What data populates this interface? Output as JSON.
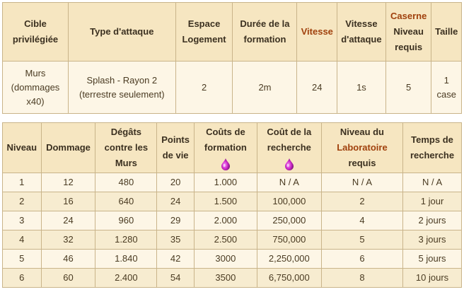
{
  "unit_table": {
    "headers": {
      "target": "Cible privilégiée",
      "attack_type": "Type d'attaque",
      "housing": "Espace Logement",
      "training_time": "Durée de la formation",
      "speed": "Vitesse",
      "attack_speed": "Vitesse d'attaque",
      "barracks_link": "Caserne",
      "barracks_level_label": "Niveau requis",
      "size": "Taille"
    },
    "row": {
      "target": "Murs (dommages x40)",
      "attack_type": "Splash - Rayon 2 (terrestre seulement)",
      "housing": "2",
      "training_time": "2m",
      "speed": "24",
      "attack_speed": "1s",
      "barracks_level": "5",
      "size": "1 case"
    }
  },
  "level_table": {
    "headers": {
      "level": "Niveau",
      "damage": "Dommage",
      "wall_damage": "Dégâts contre les Murs",
      "hitpoints": "Points de vie",
      "training_cost": "Coûts de formation",
      "research_cost": "Coût de la recherche",
      "lab_level_pre": "Niveau du",
      "lab_link": "Laboratoire",
      "lab_level_post": "requis",
      "research_time": "Temps de recherche"
    },
    "resource_icon": "elixir-drop-icon",
    "rows": [
      {
        "level": "1",
        "damage": "12",
        "wall": "480",
        "hp": "20",
        "train": "1.000",
        "research": "N / A",
        "lab": "N / A",
        "time": "N / A"
      },
      {
        "level": "2",
        "damage": "16",
        "wall": "640",
        "hp": "24",
        "train": "1.500",
        "research": "100,000",
        "lab": "2",
        "time": "1 jour"
      },
      {
        "level": "3",
        "damage": "24",
        "wall": "960",
        "hp": "29",
        "train": "2.000",
        "research": "250,000",
        "lab": "4",
        "time": "2 jours"
      },
      {
        "level": "4",
        "damage": "32",
        "wall": "1.280",
        "hp": "35",
        "train": "2.500",
        "research": "750,000",
        "lab": "5",
        "time": "3 jours"
      },
      {
        "level": "5",
        "damage": "46",
        "wall": "1.840",
        "hp": "42",
        "train": "3000",
        "research": "2,250,000",
        "lab": "6",
        "time": "5 jours"
      },
      {
        "level": "6",
        "damage": "60",
        "wall": "2.400",
        "hp": "54",
        "train": "3500",
        "research": "6,750,000",
        "lab": "8",
        "time": "10 jours"
      }
    ]
  },
  "colors": {
    "header_bg": "#f6e6c1",
    "row_bg": "#fdf6e6",
    "row_alt_bg": "#f7ecd0",
    "border": "#c9b48a",
    "link": "#a0410d",
    "elixir": "#d42fd0"
  }
}
